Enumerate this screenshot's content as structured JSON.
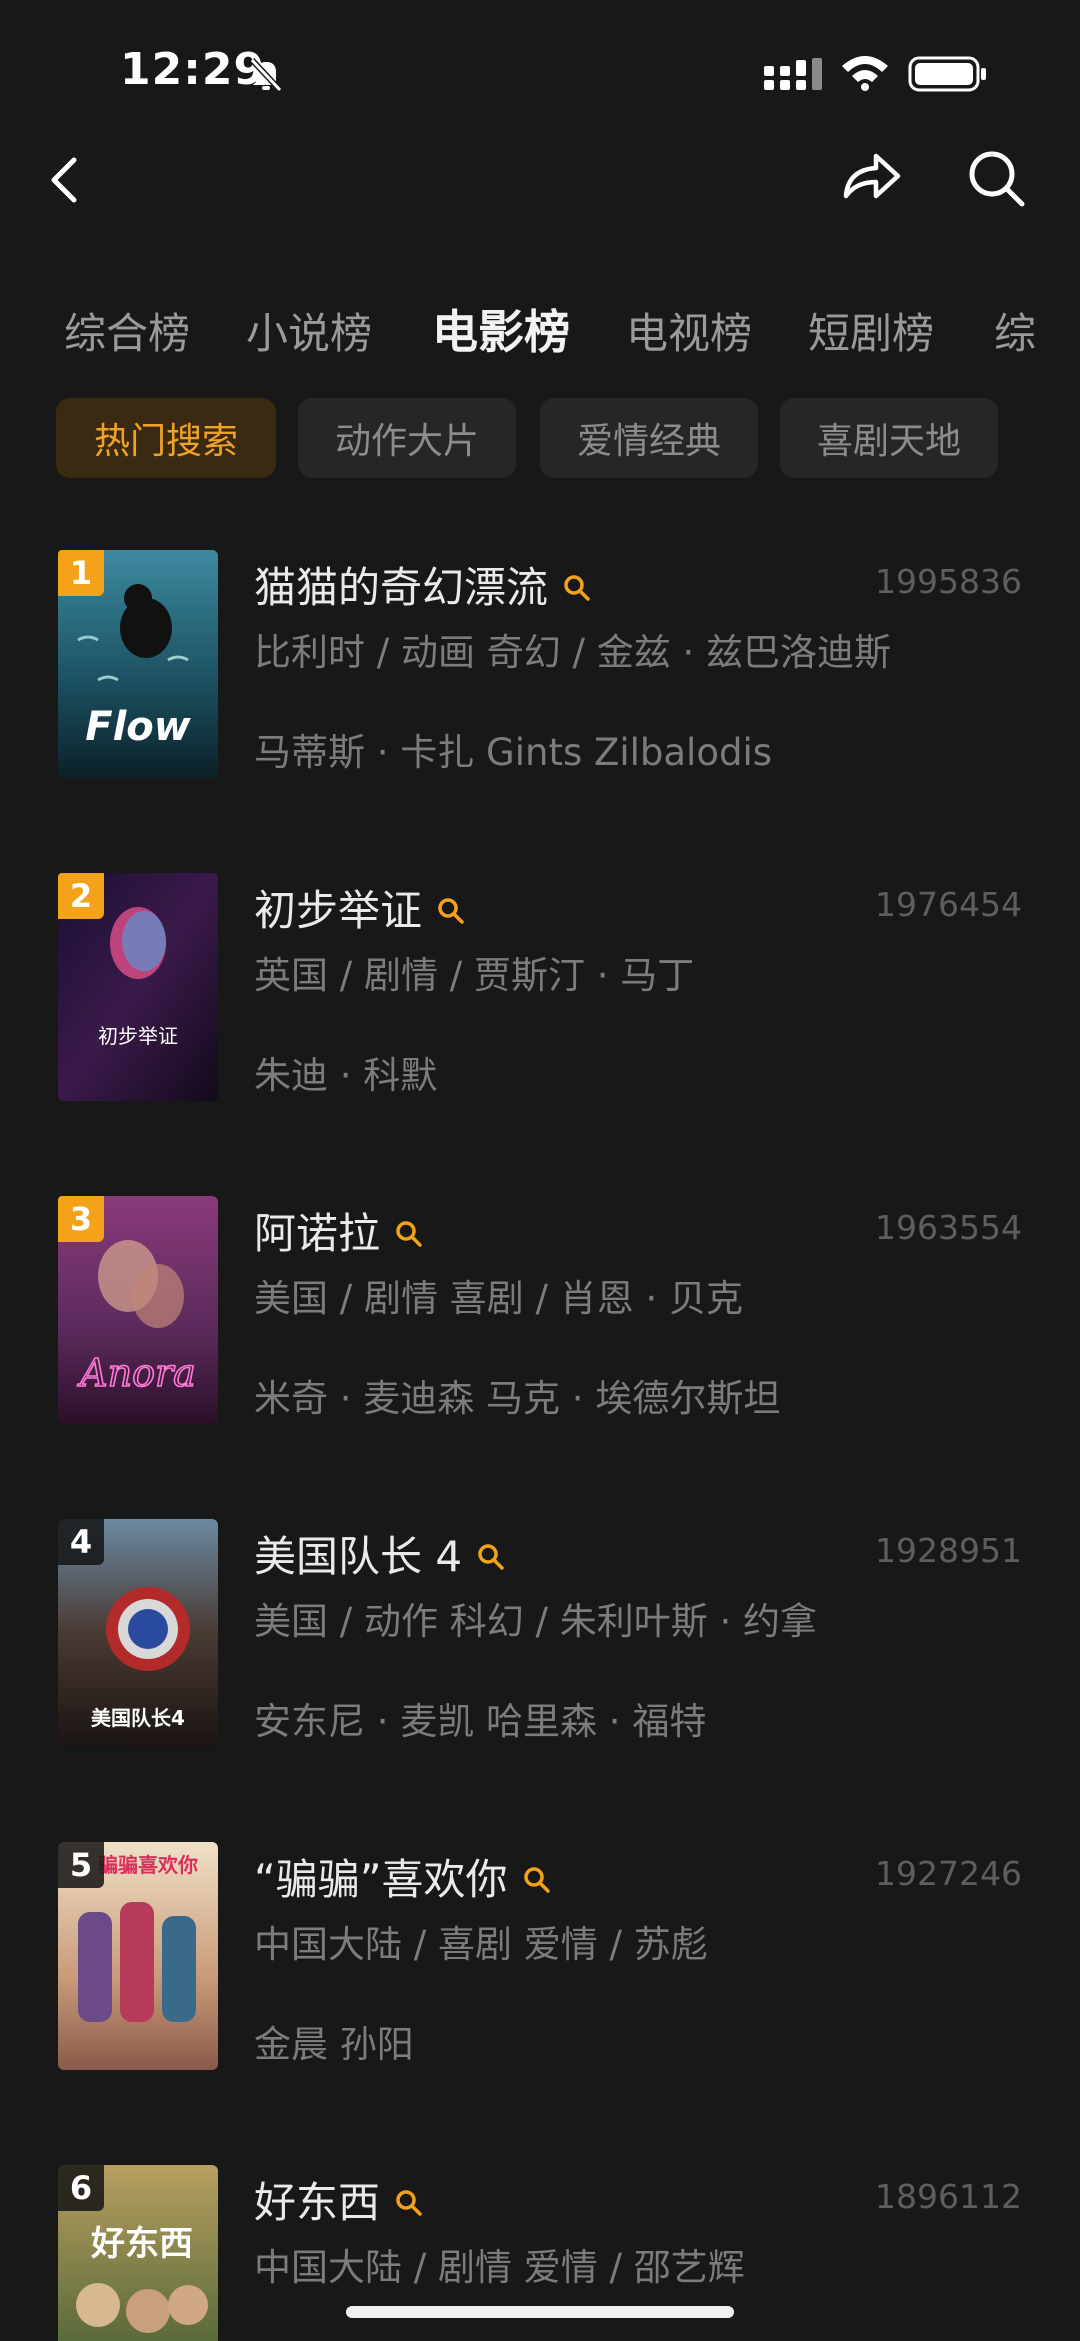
{
  "status": {
    "time": "12:29"
  },
  "category_tabs": [
    {
      "label": "综合榜",
      "active": false
    },
    {
      "label": "小说榜",
      "active": false
    },
    {
      "label": "电影榜",
      "active": true
    },
    {
      "label": "电视榜",
      "active": false
    },
    {
      "label": "短剧榜",
      "active": false
    },
    {
      "label": "综",
      "active": false
    }
  ],
  "sub_tabs": [
    {
      "label": "热门搜索",
      "active": true
    },
    {
      "label": "动作大片",
      "active": false
    },
    {
      "label": "爱情经典",
      "active": false
    },
    {
      "label": "喜剧天地",
      "active": false
    }
  ],
  "items": [
    {
      "rank": "1",
      "title": "猫猫的奇幻漂流",
      "count": "1995836",
      "meta1": "比利时 / 动画 奇幻 / 金兹 · 兹巴洛迪斯",
      "meta2": "马蒂斯 · 卡扎 Gints Zilbalodis",
      "poster_text": "Flow",
      "poster_color": "#1f5a6e"
    },
    {
      "rank": "2",
      "title": "初步举证",
      "count": "1976454",
      "meta1": "英国 / 剧情 / 贾斯汀 · 马丁",
      "meta2": "朱迪 · 科默",
      "poster_text": "初步举证",
      "poster_color": "#2b1a3d"
    },
    {
      "rank": "3",
      "title": "阿诺拉",
      "count": "1963554",
      "meta1": "美国 / 剧情 喜剧 / 肖恩 · 贝克",
      "meta2": "米奇 · 麦迪森 马克 · 埃德尔斯坦",
      "poster_text": "Anora",
      "poster_color": "#5a2a4a"
    },
    {
      "rank": "4",
      "title": "美国队长 4",
      "count": "1928951",
      "meta1": "美国 / 动作 科幻 / 朱利叶斯 · 约拿",
      "meta2": "安东尼 · 麦凯 哈里森 · 福特",
      "poster_text": "美国队长4",
      "poster_color": "#3a2a24"
    },
    {
      "rank": "5",
      "title": "“骗骗”喜欢你",
      "count": "1927246",
      "meta1": "中国大陆 / 喜剧 爱情 / 苏彪",
      "meta2": "金晨 孙阳",
      "poster_text": "骗骗喜欢你",
      "poster_color": "#c9a27a"
    },
    {
      "rank": "6",
      "title": "好东西",
      "count": "1896112",
      "meta1": "中国大陆 / 剧情 爱情 / 邵艺辉",
      "meta2": "",
      "poster_text": "好东西",
      "poster_color": "#7a6a3a"
    }
  ]
}
